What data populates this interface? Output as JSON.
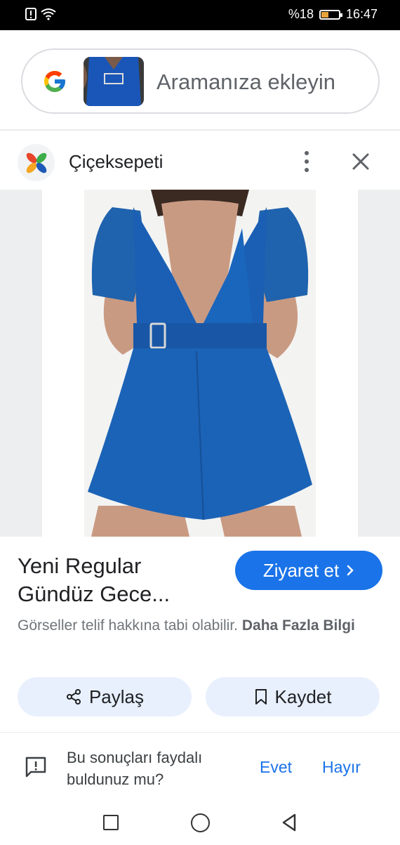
{
  "status_bar": {
    "battery": "%18",
    "time": "16:47",
    "battery_level": 0.18
  },
  "search": {
    "text": "Aramanıza ekleyin"
  },
  "source": {
    "name": "Çiçeksepeti"
  },
  "product": {
    "title": "Yeni Regular Gündüz Gece...",
    "visit_label": "Ziyaret et",
    "copyright_text": "Görseller telif hakkına tabi olabilir.",
    "more_info_label": "Daha Fazla Bilgi"
  },
  "actions": {
    "share_label": "Paylaş",
    "save_label": "Kaydet"
  },
  "feedback": {
    "question": "Bu sonuçları faydalı buldunuz mu?",
    "yes_label": "Evet",
    "no_label": "Hayır"
  },
  "colors": {
    "accent": "#1a73e8",
    "dress": "#1a5fb4",
    "pill_bg": "#e8f0fe"
  }
}
